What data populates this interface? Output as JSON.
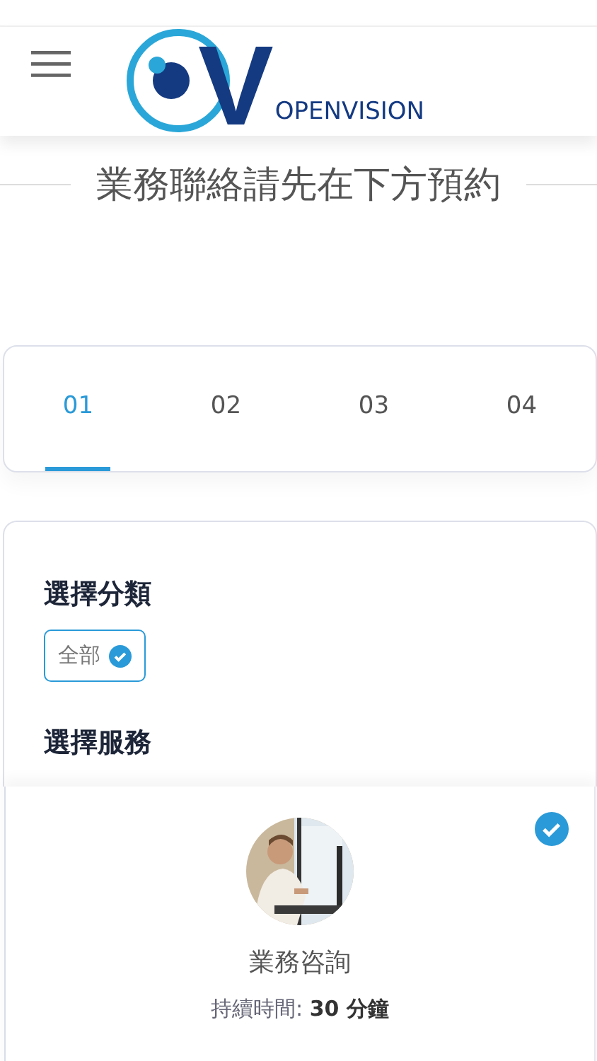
{
  "header": {
    "logo": {
      "mark": "V",
      "name": "OPENVISION"
    }
  },
  "title": "業務聯絡請先在下方預約",
  "steps": [
    {
      "label": "01",
      "selected": true
    },
    {
      "label": "02",
      "selected": false
    },
    {
      "label": "03",
      "selected": false
    },
    {
      "label": "04",
      "selected": false
    }
  ],
  "category": {
    "heading": "選擇分類",
    "chips": [
      {
        "label": "全部",
        "selected": true
      }
    ]
  },
  "service": {
    "heading": "選擇服務",
    "items": [
      {
        "name": "業務咨詢",
        "duration": "持續時間: **30 分鐘**",
        "selected": true
      }
    ]
  }
}
